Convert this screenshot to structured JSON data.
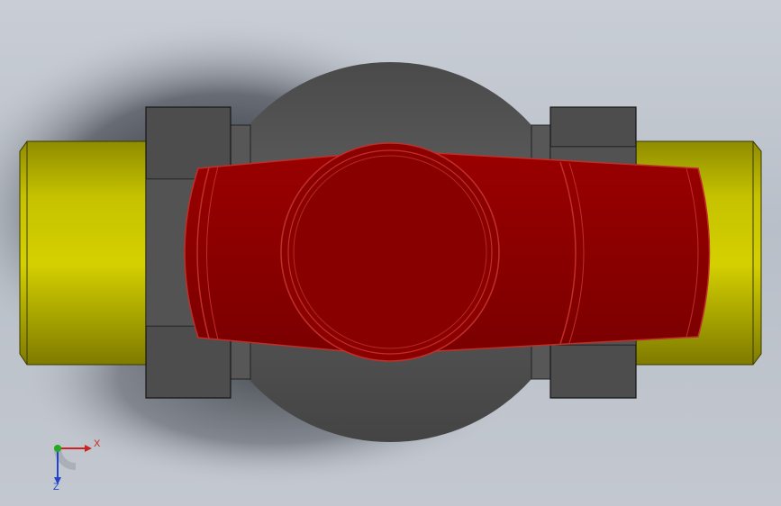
{
  "viewport": {
    "background": "#c3c8d0",
    "model": "ball-valve"
  },
  "colors": {
    "pipe": "#c8c400",
    "pipe_dark": "#8e8b00",
    "nut": "#4a4a4a",
    "body": "#555555",
    "handle": "#8b0000",
    "handle_edge": "#c0302a",
    "shadow": "#1f2228"
  },
  "triad": {
    "x_label": "X",
    "z_label": "Z",
    "x_color": "#cc2222",
    "y_color": "#22aa22",
    "z_color": "#2244cc"
  }
}
